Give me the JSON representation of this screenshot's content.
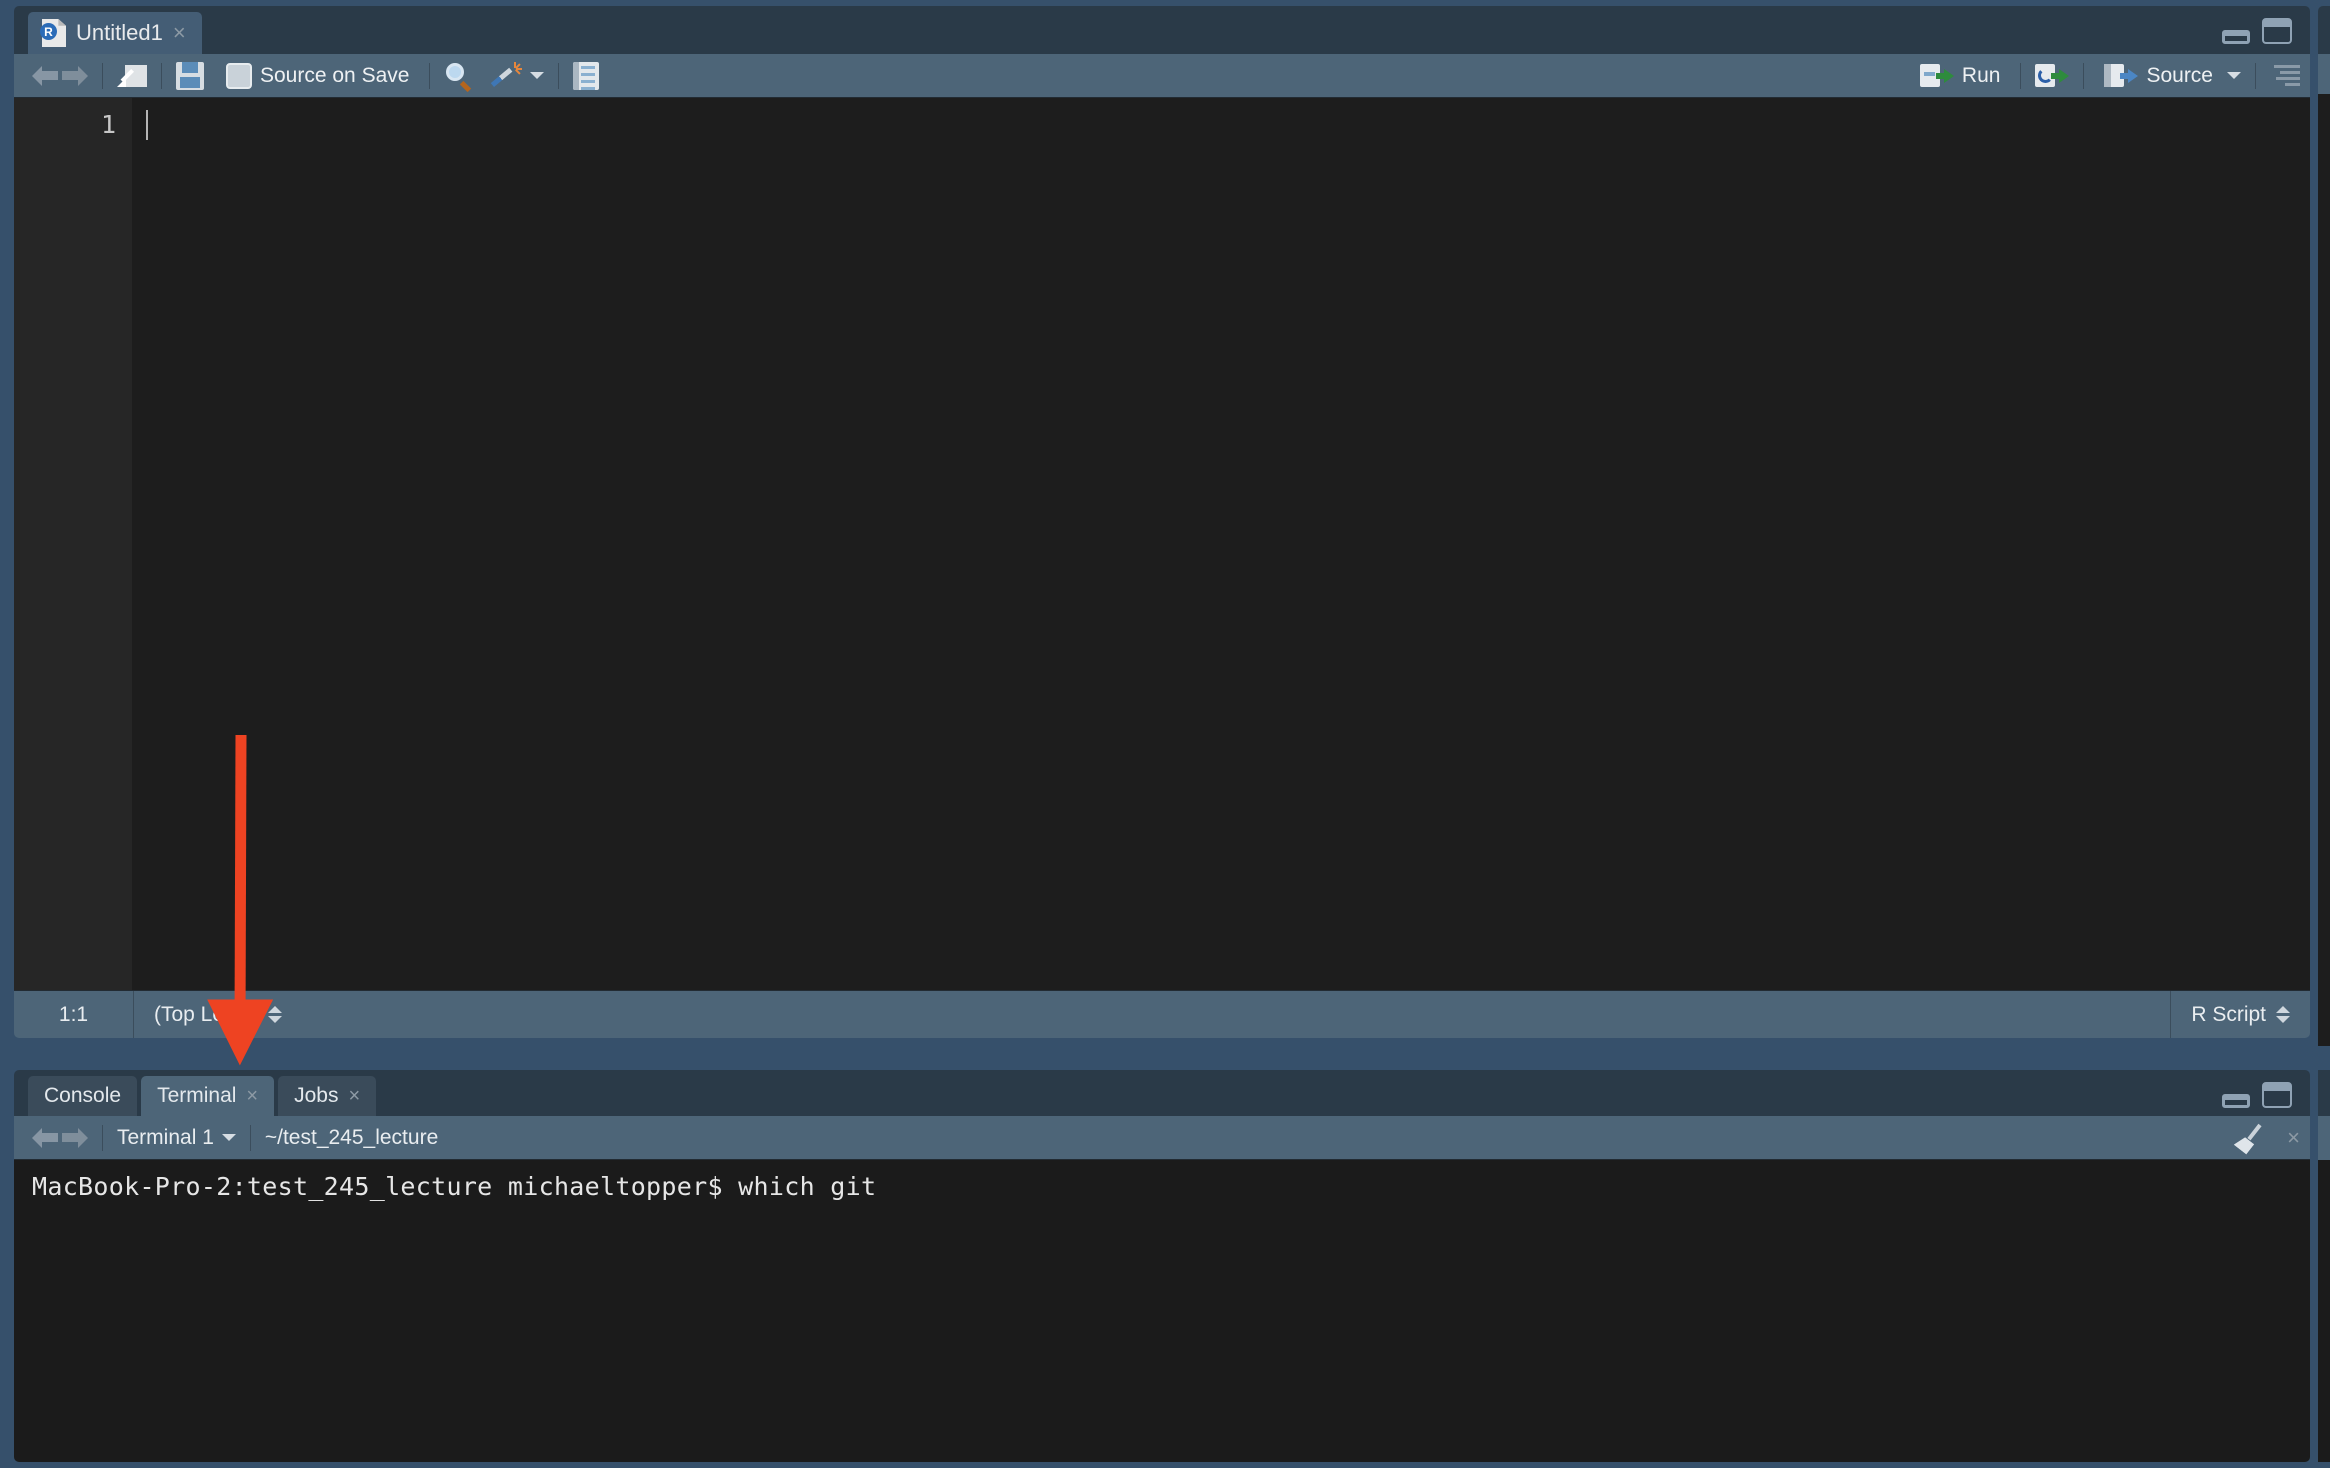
{
  "source_pane": {
    "tab": {
      "title": "Untitled1",
      "icon": "r-script-file-icon",
      "close": "×"
    },
    "window_controls": {
      "minimize": "minimize-icon",
      "maximize": "maximize-icon"
    },
    "toolbar": {
      "back": "back-arrow-icon",
      "forward": "forward-arrow-icon",
      "popout": "show-in-new-window-icon",
      "save": "save-icon",
      "source_on_save_label": "Source on Save",
      "find": "find-replace-icon",
      "code_tools": "code-tools-magic-wand-icon",
      "compile_report": "compile-report-icon",
      "run_label": "Run",
      "rerun": "rerun-previous-icon",
      "source_label": "Source",
      "outline": "document-outline-icon"
    },
    "editor": {
      "line_numbers": [
        "1"
      ],
      "lines": [
        ""
      ]
    },
    "status": {
      "cursor_position": "1:1",
      "scope": "(Top Level)",
      "file_type": "R Script"
    }
  },
  "console_pane": {
    "tabs": [
      {
        "label": "Console",
        "active": false,
        "closable": false
      },
      {
        "label": "Terminal",
        "active": true,
        "closable": true,
        "close": "×"
      },
      {
        "label": "Jobs",
        "active": false,
        "closable": true,
        "close": "×"
      }
    ],
    "window_controls": {
      "minimize": "minimize-icon",
      "maximize": "maximize-icon"
    },
    "toolbar": {
      "back": "back-arrow-icon",
      "forward": "forward-arrow-icon",
      "terminal_selector": "Terminal 1",
      "terminal_selector_caret": "chevron-down-icon",
      "working_directory": "~/test_245_lecture",
      "clear": "clear-broom-icon",
      "close": "×"
    },
    "terminal_output": [
      "MacBook-Pro-2:test_245_lecture michaeltopper$ which git"
    ]
  },
  "annotation": {
    "type": "arrow",
    "color": "#ee4322",
    "points_to": "Terminal tab"
  }
}
